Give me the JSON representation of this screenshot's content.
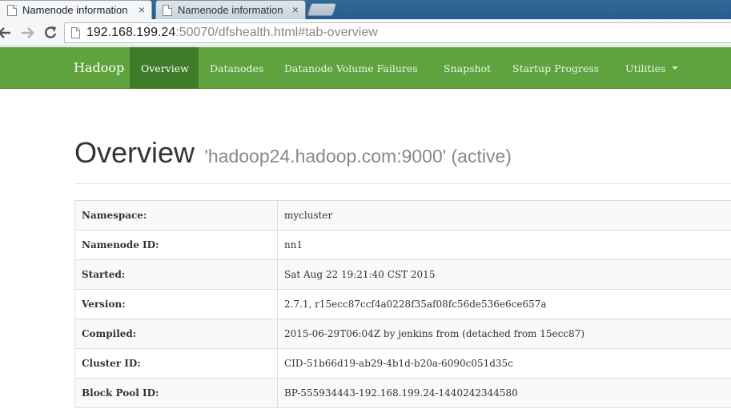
{
  "browser": {
    "tabs": [
      {
        "title": "Namenode information",
        "close": "×"
      },
      {
        "title": "Namenode information",
        "close": "×"
      }
    ],
    "url_host": "192.168.199.24",
    "url_rest": ":50070/dfshealth.html#tab-overview",
    "icons": {
      "back": "back-arrow-icon",
      "forward": "forward-arrow-icon",
      "reload": "reload-icon",
      "page": "page-icon"
    }
  },
  "navbar": {
    "brand": "Hadoop",
    "items": [
      {
        "label": "Overview",
        "active": true
      },
      {
        "label": "Datanodes",
        "active": false
      },
      {
        "label": "Datanode Volume Failures",
        "active": false
      },
      {
        "label": "Snapshot",
        "active": false
      },
      {
        "label": "Startup Progress",
        "active": false
      },
      {
        "label": "Utilities",
        "active": false,
        "dropdown": true
      }
    ],
    "colors": {
      "background": "#5fa33e",
      "active": "#3f7b28"
    }
  },
  "overview": {
    "title": "Overview",
    "subtitle": "'hadoop24.hadoop.com:9000' (active)",
    "rows": [
      {
        "key": "Namespace:",
        "value": "mycluster"
      },
      {
        "key": "Namenode ID:",
        "value": "nn1"
      },
      {
        "key": "Started:",
        "value": "Sat Aug 22 19:21:40 CST 2015"
      },
      {
        "key": "Version:",
        "value": "2.7.1, r15ecc87ccf4a0228f35af08fc56de536e6ce657a"
      },
      {
        "key": "Compiled:",
        "value": "2015-06-29T06:04Z by jenkins from (detached from 15ecc87)"
      },
      {
        "key": "Cluster ID:",
        "value": "CID-51b66d19-ab29-4b1d-b20a-6090c051d35c"
      },
      {
        "key": "Block Pool ID:",
        "value": "BP-555934443-192.168.199.24-1440242344580"
      }
    ]
  }
}
